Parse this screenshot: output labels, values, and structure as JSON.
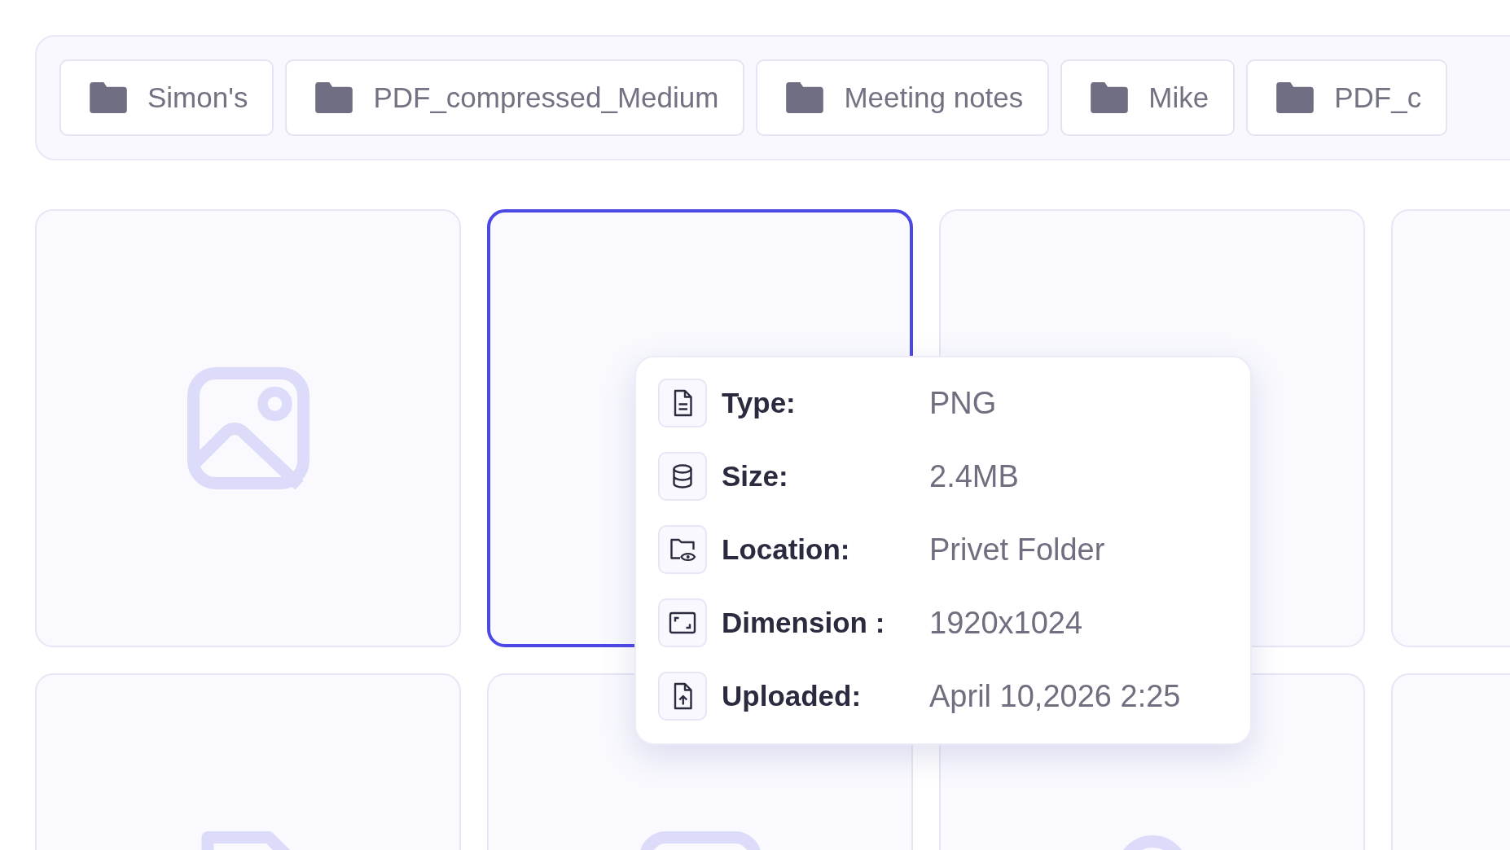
{
  "folders": [
    {
      "name": "Simon's"
    },
    {
      "name": "PDF_compressed_Medium"
    },
    {
      "name": "Meeting notes"
    },
    {
      "name": "Mike"
    },
    {
      "name": "PDF_c"
    }
  ],
  "cards": [
    {
      "kind": "image",
      "selected": false
    },
    {
      "kind": "blank",
      "selected": true
    },
    {
      "kind": "blank",
      "selected": false
    },
    {
      "kind": "blank",
      "selected": false
    },
    {
      "kind": "document",
      "selected": false
    },
    {
      "kind": "video",
      "selected": false
    },
    {
      "kind": "audio",
      "selected": false
    },
    {
      "kind": "blank",
      "selected": false
    }
  ],
  "details": [
    {
      "kind": "type",
      "label": "Type:",
      "value": "PNG"
    },
    {
      "kind": "size",
      "label": "Size:",
      "value": "2.4MB"
    },
    {
      "kind": "location",
      "label": "Location:",
      "value": "Privet Folder"
    },
    {
      "kind": "dimension",
      "label": "Dimension :",
      "value": "1920x1024"
    },
    {
      "kind": "uploaded",
      "label": "Uploaded:",
      "value": "April 10,2026 2:25"
    }
  ]
}
